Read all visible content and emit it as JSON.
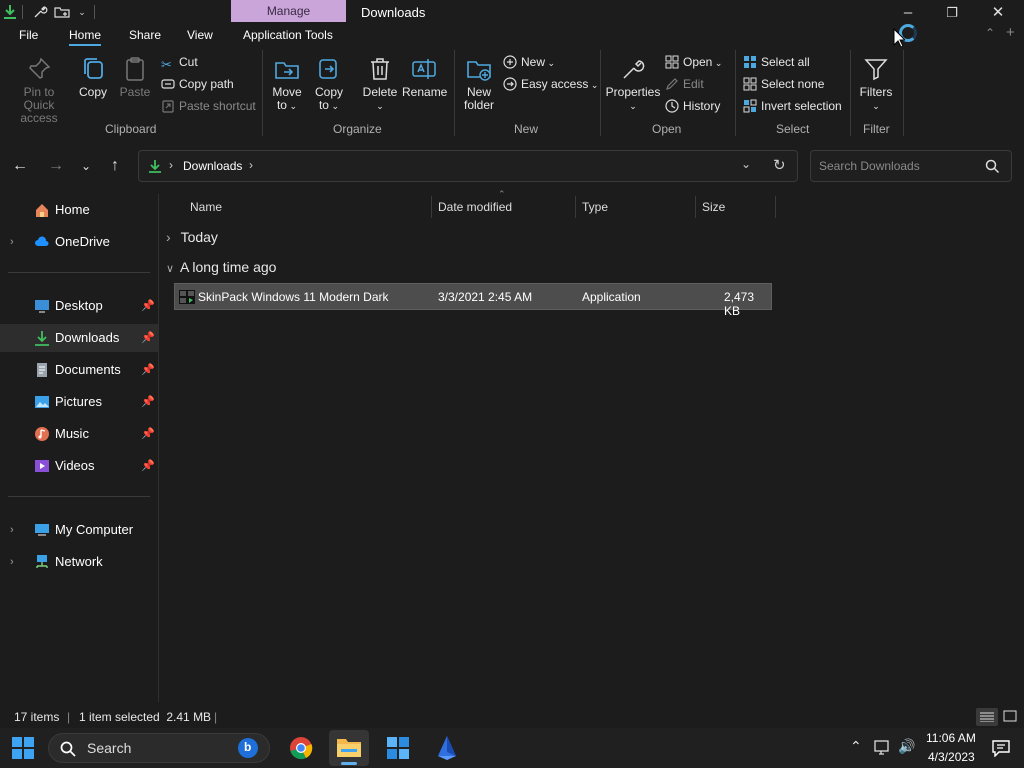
{
  "titlebar": {
    "context_tab": "Manage",
    "title": "Downloads"
  },
  "menu": {
    "tabs": [
      "File",
      "Home",
      "Share",
      "View",
      "Application Tools"
    ],
    "active": "Home"
  },
  "ribbon": {
    "clipboard": {
      "pin": "Pin to Quick access",
      "copy": "Copy",
      "paste": "Paste",
      "cut": "Cut",
      "copy_path": "Copy path",
      "paste_shortcut": "Paste shortcut",
      "label": "Clipboard"
    },
    "organize": {
      "move_to_l1": "Move",
      "move_to_l2": "to",
      "copy_to_l1": "Copy",
      "copy_to_l2": "to",
      "delete": "Delete",
      "rename": "Rename",
      "label": "Organize"
    },
    "new": {
      "new_folder_l1": "New",
      "new_folder_l2": "folder",
      "new_item": "New",
      "easy_access": "Easy access",
      "label": "New"
    },
    "open": {
      "properties": "Properties",
      "open": "Open",
      "edit": "Edit",
      "history": "History",
      "label": "Open"
    },
    "select": {
      "select_all": "Select all",
      "select_none": "Select none",
      "invert": "Invert selection",
      "label": "Select"
    },
    "filter": {
      "filters": "Filters",
      "label": "Filter"
    }
  },
  "address": {
    "path": "Downloads",
    "search_placeholder": "Search Downloads"
  },
  "sidebar": {
    "items": [
      {
        "label": "Home",
        "icon": "home-icon"
      },
      {
        "label": "OneDrive",
        "icon": "cloud-icon"
      },
      {
        "label": "Desktop",
        "icon": "desktop-icon"
      },
      {
        "label": "Downloads",
        "icon": "download-icon"
      },
      {
        "label": "Documents",
        "icon": "document-icon"
      },
      {
        "label": "Pictures",
        "icon": "picture-icon"
      },
      {
        "label": "Music",
        "icon": "music-icon"
      },
      {
        "label": "Videos",
        "icon": "video-icon"
      },
      {
        "label": "My Computer",
        "icon": "computer-icon"
      },
      {
        "label": "Network",
        "icon": "network-icon"
      }
    ]
  },
  "columns": {
    "name": "Name",
    "date": "Date modified",
    "type": "Type",
    "size": "Size"
  },
  "groups": {
    "today": "Today",
    "long_ago": "A long time ago"
  },
  "file": {
    "name": "SkinPack Windows 11 Modern Dark",
    "date": "3/3/2021 2:45 AM",
    "type": "Application",
    "size": "2,473 KB"
  },
  "status": {
    "count": "17 items",
    "selection": "1 item selected  2.41 MB"
  },
  "taskbar": {
    "search": "Search",
    "time": "11:06 AM",
    "date": "4/3/2023"
  },
  "colors": {
    "accent": "#4ea8e0",
    "manage_tab": "#c9a5d9",
    "download_green": "#3fbf5f"
  }
}
